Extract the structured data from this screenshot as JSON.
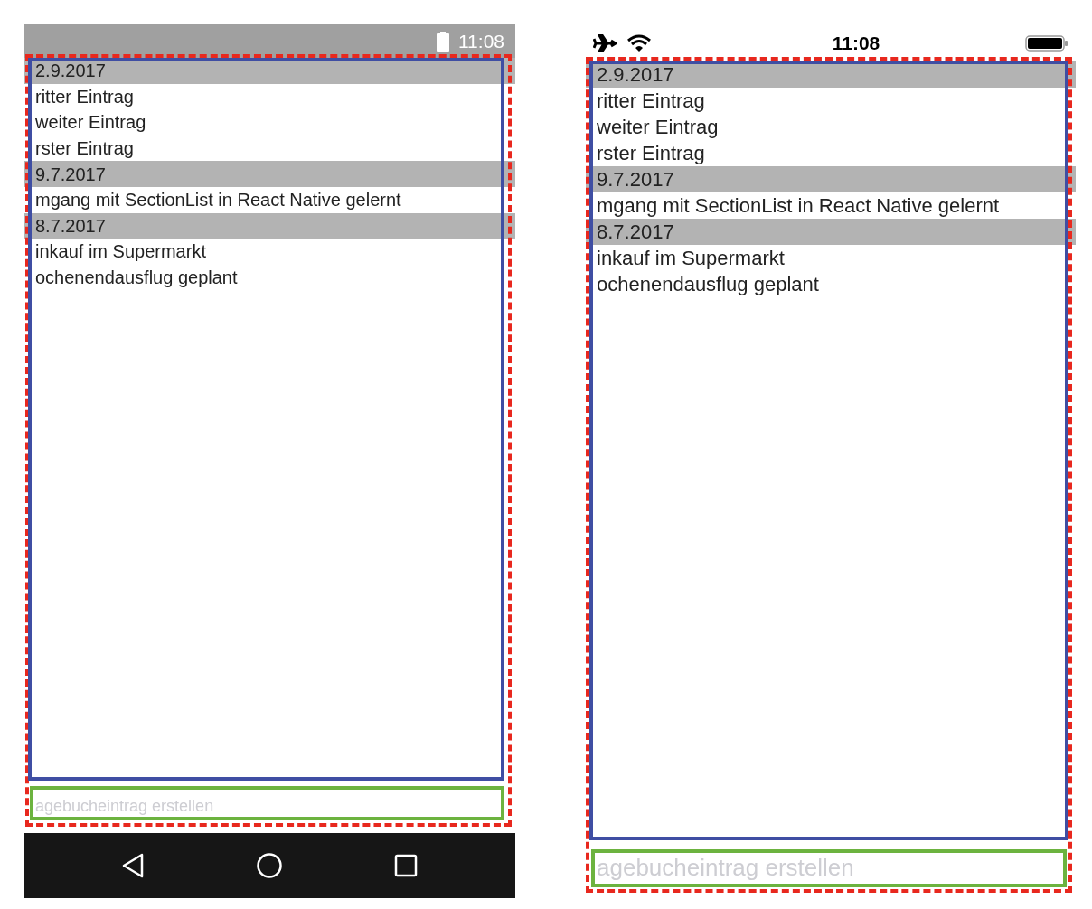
{
  "phones": [
    {
      "kind": "android",
      "status_bar": {
        "time": "11:08"
      },
      "sections": [
        {
          "header": "2.9.2017",
          "items": [
            "ritter Eintrag",
            "weiter Eintrag",
            "rster Eintrag"
          ]
        },
        {
          "header": "9.7.2017",
          "items": [
            "mgang mit SectionList in React Native gelernt"
          ]
        },
        {
          "header": "8.7.2017",
          "items": [
            "inkauf im Supermarkt",
            "ochenendausflug geplant"
          ]
        }
      ],
      "input": {
        "placeholder": "agebucheintrag erstellen"
      }
    },
    {
      "kind": "ios",
      "status_bar": {
        "time": "11:08"
      },
      "sections": [
        {
          "header": "2.9.2017",
          "items": [
            "ritter Eintrag",
            "weiter Eintrag",
            "rster Eintrag"
          ]
        },
        {
          "header": "9.7.2017",
          "items": [
            "mgang mit SectionList in React Native gelernt"
          ]
        },
        {
          "header": "8.7.2017",
          "items": [
            "inkauf im Supermarkt",
            "ochenendausflug geplant"
          ]
        }
      ],
      "input": {
        "placeholder": "agebucheintrag erstellen"
      }
    }
  ]
}
